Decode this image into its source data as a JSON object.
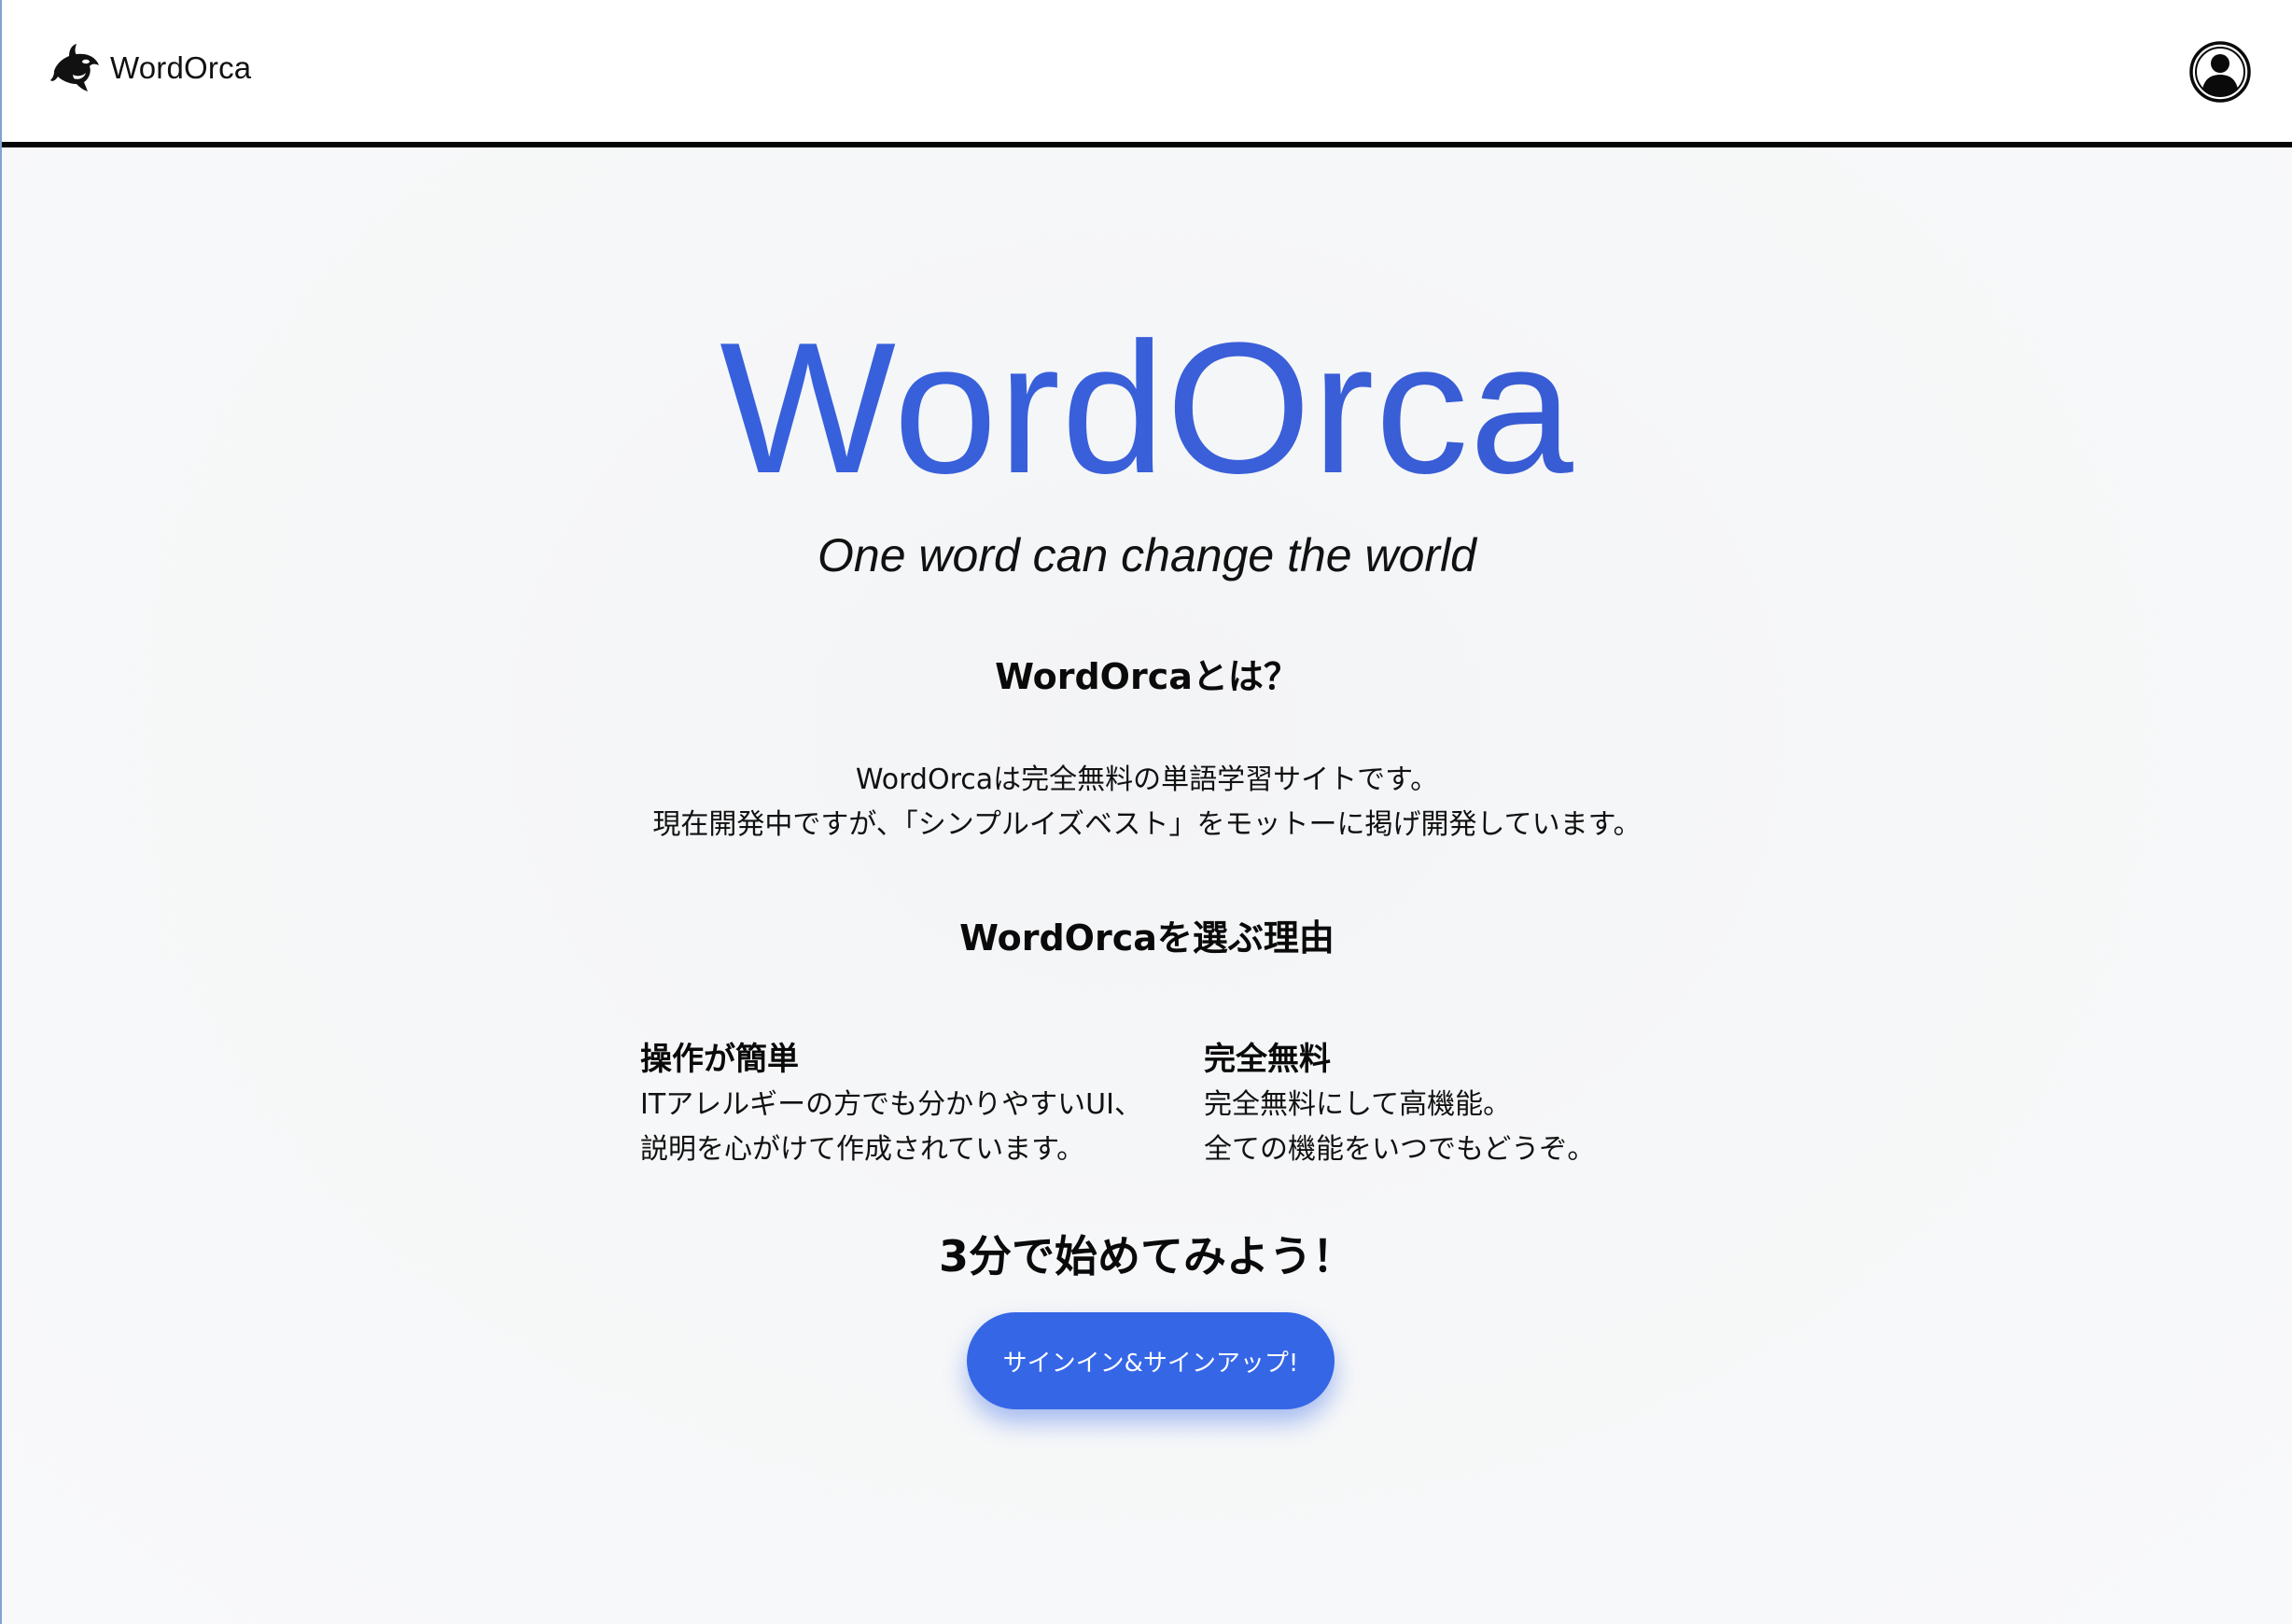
{
  "colors": {
    "accent": "#3566e6",
    "title_gradient_start": "#3261e3",
    "title_gradient_end": "#3254c9",
    "navbar_border": "#050505"
  },
  "navbar": {
    "logo_icon": "orca-icon",
    "brand_name": "WordOrca",
    "account_icon": "user-avatar-icon"
  },
  "hero": {
    "title": "WordOrca",
    "tagline": "One word can change the world"
  },
  "about": {
    "heading": "WordOrcaとは？",
    "lines": [
      "WordOrcaは完全無料の単語学習サイトです。",
      "現在開発中ですが、「シンプルイズベスト」をモットーに掲げ開発しています。"
    ]
  },
  "reasons": {
    "heading": "WordOrcaを選ぶ理由",
    "items": [
      {
        "title": "操作が簡単",
        "lines": [
          "ITアレルギーの方でも分かりやすいUI、",
          "説明を心がけて作成されています。"
        ]
      },
      {
        "title": "完全無料",
        "lines": [
          "完全無料にして高機能。",
          "全ての機能をいつでもどうぞ。"
        ]
      }
    ]
  },
  "cta": {
    "heading": "3分で始めてみよう！",
    "button_label": "サインイン&サインアップ!"
  }
}
